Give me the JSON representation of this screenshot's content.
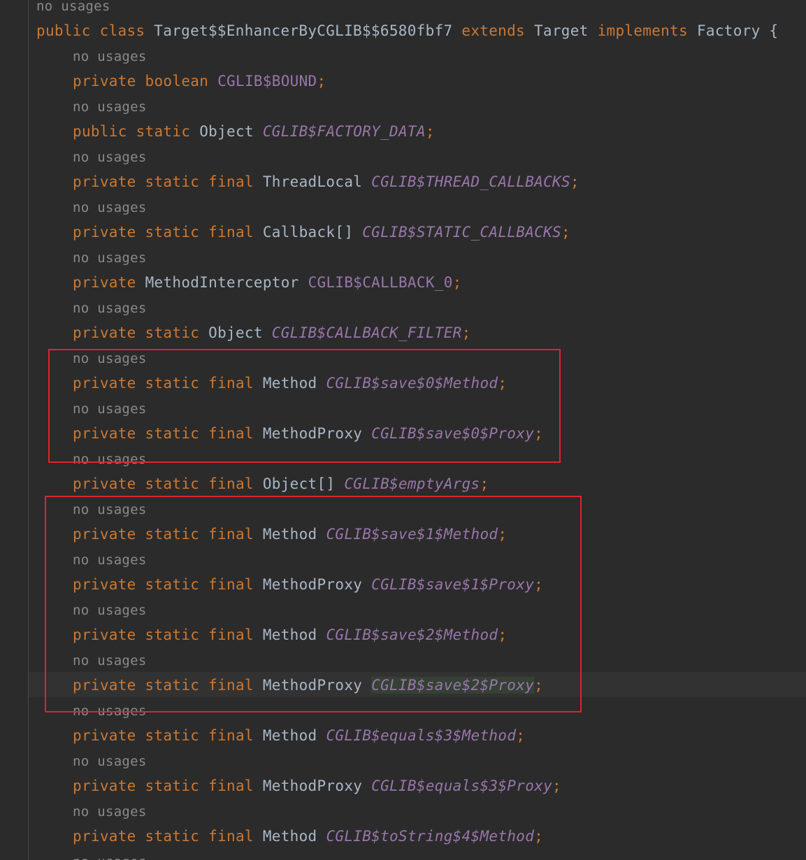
{
  "code": {
    "hint_top": "no usages",
    "class_decl": {
      "kw_public": "public",
      "kw_class": "class",
      "class_name": "Target$$EnhancerByCGLIB$$6580fbf7",
      "kw_extends": "extends",
      "super_name": "Target",
      "kw_implements": "implements",
      "iface_name": "Factory",
      "brace": "{"
    },
    "hint": "no usages",
    "fields": [
      {
        "mods": "private boolean",
        "type": "",
        "name": "CGLIB$BOUND",
        "italic": false
      },
      {
        "mods": "public static",
        "type": "Object",
        "name": "CGLIB$FACTORY_DATA",
        "italic": true
      },
      {
        "mods": "private static final",
        "type": "ThreadLocal",
        "name": "CGLIB$THREAD_CALLBACKS",
        "italic": true
      },
      {
        "mods": "private static final",
        "type": "Callback[]",
        "name": "CGLIB$STATIC_CALLBACKS",
        "italic": true
      },
      {
        "mods": "private",
        "type": "MethodInterceptor",
        "name": "CGLIB$CALLBACK_0",
        "italic": false
      },
      {
        "mods": "private static",
        "type": "Object",
        "name": "CGLIB$CALLBACK_FILTER",
        "italic": true
      },
      {
        "mods": "private static final",
        "type": "Method",
        "name": "CGLIB$save$0$Method",
        "italic": true
      },
      {
        "mods": "private static final",
        "type": "MethodProxy",
        "name": "CGLIB$save$0$Proxy",
        "italic": true
      },
      {
        "mods": "private static final",
        "type": "Object[]",
        "name": "CGLIB$emptyArgs",
        "italic": true
      },
      {
        "mods": "private static final",
        "type": "Method",
        "name": "CGLIB$save$1$Method",
        "italic": true
      },
      {
        "mods": "private static final",
        "type": "MethodProxy",
        "name": "CGLIB$save$1$Proxy",
        "italic": true
      },
      {
        "mods": "private static final",
        "type": "Method",
        "name": "CGLIB$save$2$Method",
        "italic": true
      },
      {
        "mods": "private static final",
        "type": "MethodProxy",
        "name": "CGLIB$save$2$Proxy",
        "italic": true
      },
      {
        "mods": "private static final",
        "type": "Method",
        "name": "CGLIB$equals$3$Method",
        "italic": true
      },
      {
        "mods": "private static final",
        "type": "MethodProxy",
        "name": "CGLIB$equals$3$Proxy",
        "italic": true
      },
      {
        "mods": "private static final",
        "type": "Method",
        "name": "CGLIB$toString$4$Method",
        "italic": true
      }
    ],
    "semicolon": ";",
    "highlighted_field_index": 12
  },
  "colors": {
    "background": "#2b2b2b",
    "keyword": "#cc7832",
    "field": "#9876aa",
    "hint": "#8a8a8a",
    "annotation_box": "#e0242b",
    "usage_highlight": "#344134"
  }
}
